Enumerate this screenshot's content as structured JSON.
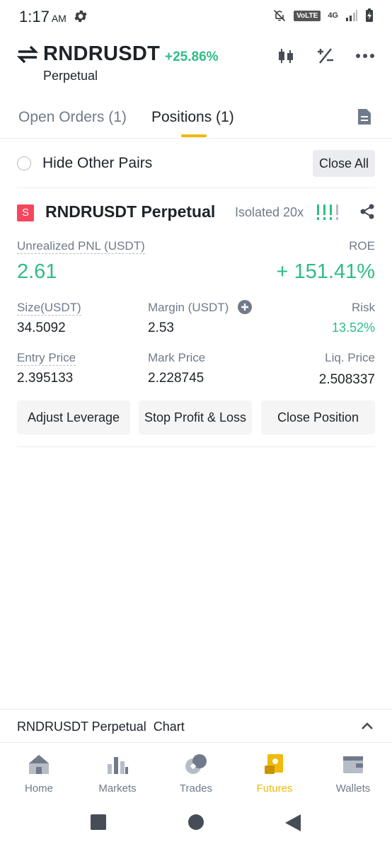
{
  "status_bar": {
    "time": "1:17",
    "ampm": "AM",
    "volte": "VoLTE",
    "network": "4G",
    "icons": [
      "settings-icon",
      "bell-off-icon",
      "signal-icon",
      "battery-icon"
    ]
  },
  "header": {
    "symbol": "RNDRUSDT",
    "change": "+25.86%",
    "contract_type": "Perpetual",
    "icons": [
      "candlestick-icon",
      "percent-icon",
      "more-icon"
    ]
  },
  "tabs": {
    "open_orders": "Open Orders (1)",
    "positions": "Positions (1)",
    "active": "positions"
  },
  "filter": {
    "hide_other_pairs": "Hide Other Pairs",
    "close_all": "Close All"
  },
  "position": {
    "side_badge": "S",
    "title": "RNDRUSDT Perpetual",
    "margin_mode": "Isolated 20x",
    "unrealized_pnl_label": "Unrealized PNL (USDT)",
    "unrealized_pnl": "2.61",
    "roe_label": "ROE",
    "roe": "+ 151.41%",
    "size_label": "Size(USDT)",
    "size": "34.5092",
    "margin_label": "Margin (USDT)",
    "margin": "2.53",
    "risk_label": "Risk",
    "risk": "13.52%",
    "entry_price_label": "Entry Price",
    "entry_price": "2.395133",
    "mark_price_label": "Mark Price",
    "mark_price": "2.228745",
    "liq_price_label": "Liq. Price",
    "liq_price": "2.508337",
    "buttons": {
      "adjust_leverage": "Adjust Leverage",
      "stop_profit_loss": "Stop Profit & Loss",
      "close_position": "Close Position"
    }
  },
  "chart_bar": {
    "label": "RNDRUSDT Perpetual  Chart"
  },
  "bottom_nav": {
    "items": [
      {
        "label": "Home",
        "icon": "home-icon"
      },
      {
        "label": "Markets",
        "icon": "markets-icon"
      },
      {
        "label": "Trades",
        "icon": "trades-icon"
      },
      {
        "label": "Futures",
        "icon": "futures-icon"
      },
      {
        "label": "Wallets",
        "icon": "wallet-icon"
      }
    ],
    "active": "Futures"
  },
  "colors": {
    "accent": "#f0b90b",
    "positive": "#2ebd85",
    "negative": "#f6465d",
    "text_primary": "#1e2329",
    "text_secondary": "#707a8a"
  }
}
